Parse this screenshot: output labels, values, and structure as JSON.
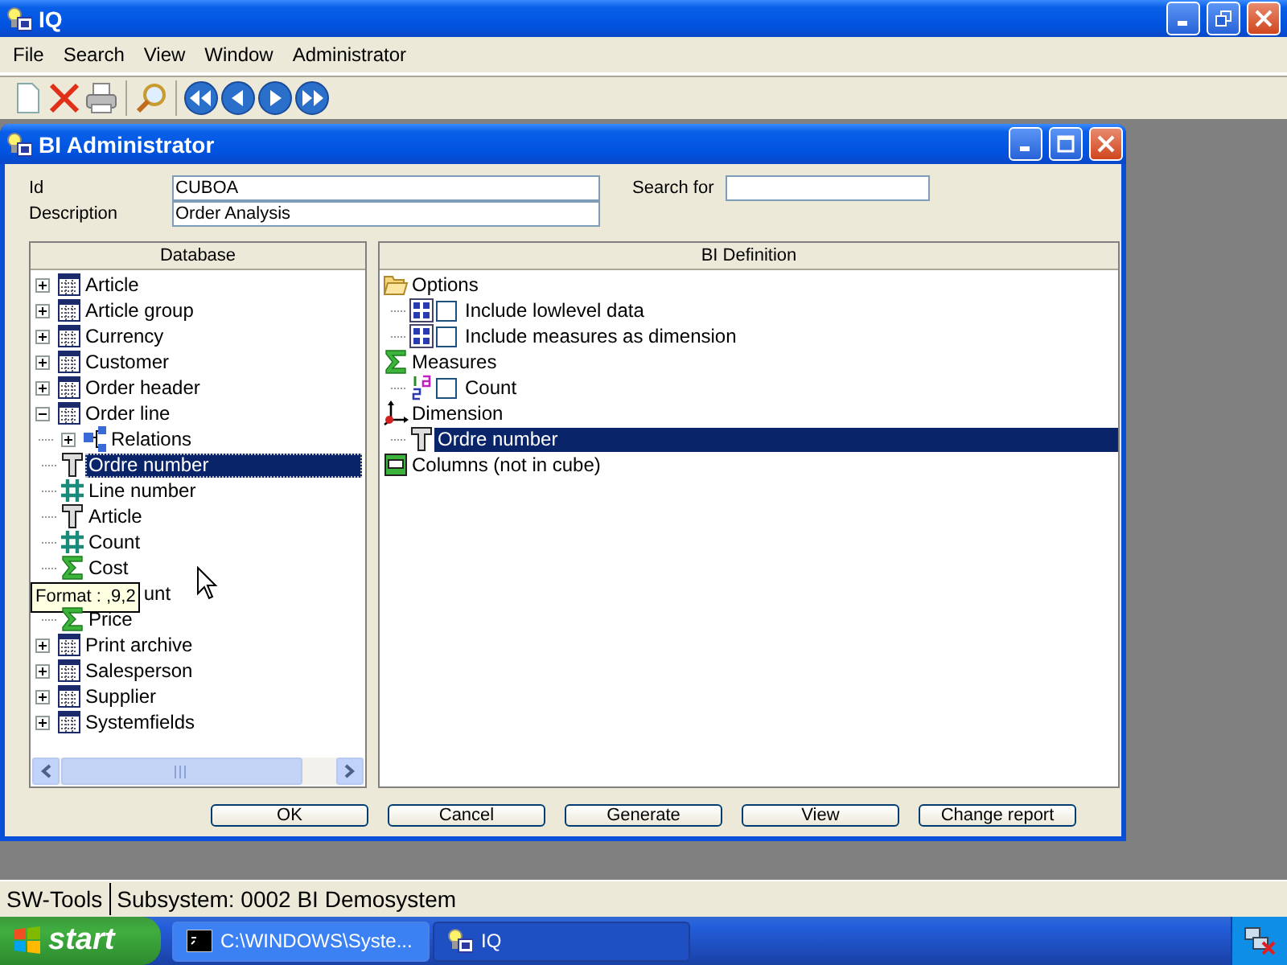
{
  "app": {
    "title": "IQ"
  },
  "menu": [
    "File",
    "Search",
    "View",
    "Window",
    "Administrator"
  ],
  "dialog": {
    "title": "BI Administrator",
    "fields": [
      {
        "label": "Id",
        "value": "CUBOA"
      },
      {
        "label": "Description",
        "value": "Order Analysis"
      }
    ],
    "search": {
      "label": "Search for"
    },
    "database": {
      "header": "Database",
      "items": [
        {
          "label": "Article",
          "kind": "table",
          "expanded": false,
          "selected": false
        },
        {
          "label": "Article group",
          "kind": "table",
          "expanded": false,
          "selected": false
        },
        {
          "label": "Currency",
          "kind": "table",
          "expanded": false,
          "selected": false
        },
        {
          "label": "Customer",
          "kind": "table",
          "expanded": false,
          "selected": false
        },
        {
          "label": "Order header",
          "kind": "table",
          "expanded": false,
          "selected": false
        },
        {
          "label": "Order line",
          "kind": "table",
          "expanded": true,
          "selected": false,
          "children": [
            {
              "label": "Relations",
              "kind": "relation",
              "expanded": false,
              "selected": false
            },
            {
              "label": "Ordre number",
              "kind": "text",
              "selected": true
            },
            {
              "label": "Line number",
              "kind": "number",
              "selected": false
            },
            {
              "label": "Article",
              "kind": "text",
              "selected": false
            },
            {
              "label": "Count",
              "kind": "number",
              "selected": false
            },
            {
              "label": "Cost",
              "kind": "sum",
              "selected": false
            },
            {
              "label": "unt",
              "selected": false,
              "tooltip": "Format : ,9,2"
            },
            {
              "label": "Price",
              "kind": "sum",
              "selected": false
            }
          ]
        },
        {
          "label": "Print archive",
          "kind": "table",
          "expanded": false,
          "selected": false
        },
        {
          "label": "Salesperson",
          "kind": "table",
          "expanded": false,
          "selected": false
        },
        {
          "label": "Supplier",
          "kind": "table",
          "expanded": false,
          "selected": false
        },
        {
          "label": "Systemfields",
          "kind": "table",
          "expanded": false,
          "selected": false
        }
      ]
    },
    "definition": {
      "header": "BI Definition",
      "items": [
        {
          "label": "Options",
          "kind": "folder",
          "selected": false,
          "children": [
            {
              "label": "Include lowlevel data",
              "kind": "option",
              "checked": false,
              "selected": false
            },
            {
              "label": "Include measures as dimension",
              "kind": "option",
              "checked": false,
              "selected": false
            }
          ]
        },
        {
          "label": "Measures",
          "kind": "sum",
          "selected": false,
          "children": [
            {
              "label": "Count",
              "kind": "numeric",
              "checked": false,
              "selected": false
            }
          ]
        },
        {
          "label": "Dimension",
          "kind": "axes",
          "selected": false,
          "children": [
            {
              "label": "Ordre number",
              "kind": "text",
              "selected": true
            }
          ]
        },
        {
          "label": "Columns (not in cube)",
          "kind": "columns",
          "selected": false
        }
      ]
    },
    "buttons": [
      "OK",
      "Cancel",
      "Generate",
      "View",
      "Change report"
    ]
  },
  "status_bar": [
    "SW-Tools",
    "Subsystem: 0002 BI Demosystem"
  ],
  "taskbar": {
    "start": "start",
    "tasks": [
      {
        "label": "C:\\WINDOWS\\Syste...",
        "kind": "console",
        "selected": false
      },
      {
        "label": "IQ",
        "kind": "app",
        "selected": true
      }
    ]
  }
}
